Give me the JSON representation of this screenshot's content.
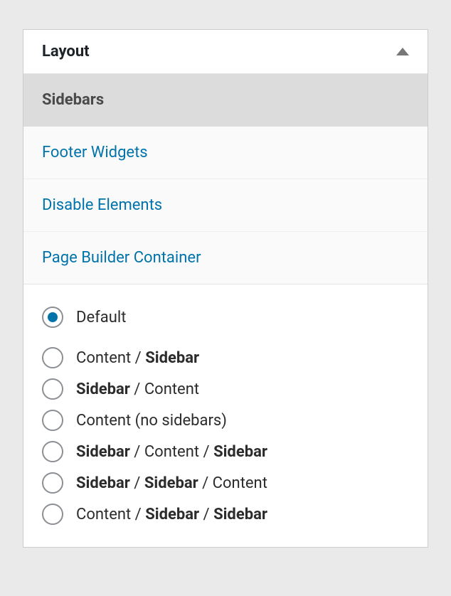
{
  "panel": {
    "title": "Layout",
    "tabs": [
      {
        "label": "Sidebars",
        "active": true
      },
      {
        "label": "Footer Widgets",
        "active": false
      },
      {
        "label": "Disable Elements",
        "active": false
      },
      {
        "label": "Page Builder Container",
        "active": false
      }
    ],
    "options": [
      {
        "parts": [
          {
            "text": "Default",
            "bold": false
          }
        ],
        "checked": true
      },
      {
        "parts": [
          {
            "text": "Content / ",
            "bold": false
          },
          {
            "text": "Sidebar",
            "bold": true
          }
        ],
        "checked": false
      },
      {
        "parts": [
          {
            "text": "Sidebar",
            "bold": true
          },
          {
            "text": " / Content",
            "bold": false
          }
        ],
        "checked": false
      },
      {
        "parts": [
          {
            "text": "Content (no sidebars)",
            "bold": false
          }
        ],
        "checked": false
      },
      {
        "parts": [
          {
            "text": "Sidebar",
            "bold": true
          },
          {
            "text": " / Content / ",
            "bold": false
          },
          {
            "text": "Sidebar",
            "bold": true
          }
        ],
        "checked": false
      },
      {
        "parts": [
          {
            "text": "Sidebar",
            "bold": true
          },
          {
            "text": " / ",
            "bold": false
          },
          {
            "text": "Sidebar",
            "bold": true
          },
          {
            "text": " / Content",
            "bold": false
          }
        ],
        "checked": false
      },
      {
        "parts": [
          {
            "text": "Content / ",
            "bold": false
          },
          {
            "text": "Sidebar",
            "bold": true
          },
          {
            "text": " / ",
            "bold": false
          },
          {
            "text": "Sidebar",
            "bold": true
          }
        ],
        "checked": false
      }
    ]
  }
}
